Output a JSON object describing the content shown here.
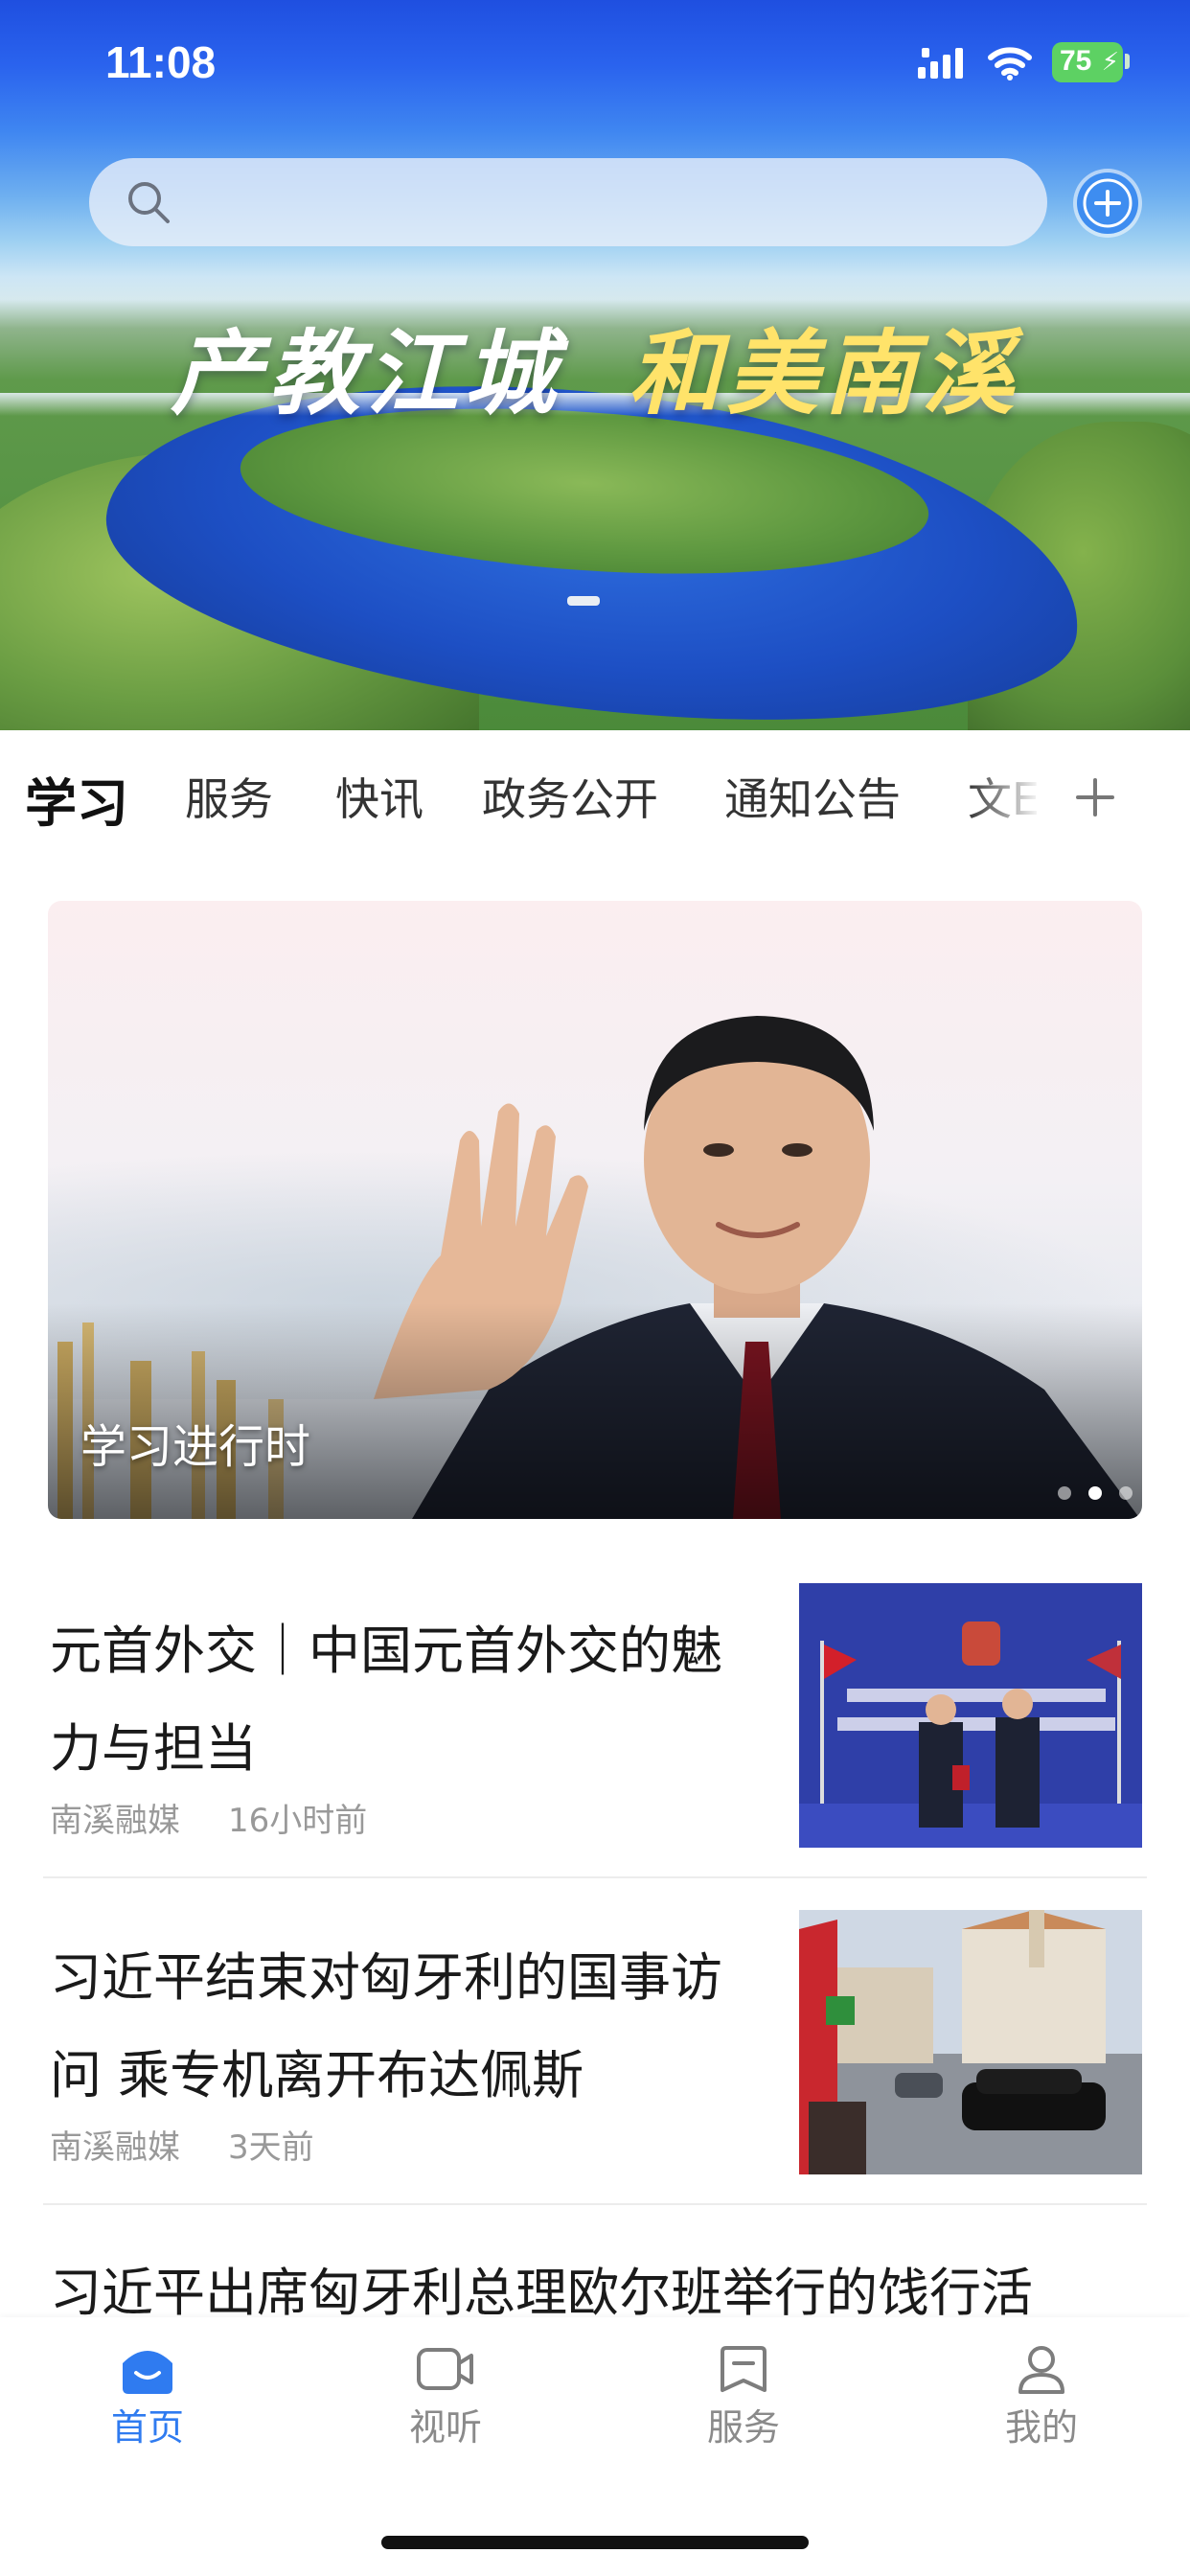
{
  "status_bar": {
    "time": "11:08",
    "battery": "75"
  },
  "header": {
    "search": {
      "placeholder": ""
    },
    "banner": {
      "slogan_part1": "产教江城",
      "slogan_part2": "和美南溪"
    }
  },
  "tabs": [
    {
      "label": "学习",
      "active": true
    },
    {
      "label": "服务"
    },
    {
      "label": "快讯"
    },
    {
      "label": "政务公开"
    },
    {
      "label": "通知公告"
    },
    {
      "label": "文E"
    }
  ],
  "carousel": {
    "caption": "学习进行时",
    "slide_count": 3,
    "active_index": 1
  },
  "news": [
    {
      "title": "元首外交｜中国元首外交的魅力与担当",
      "source": "南溪融媒",
      "time": "16小时前"
    },
    {
      "title": "习近平结束对匈牙利的国事访问 乘专机离开布达佩斯",
      "source": "南溪融媒",
      "time": "3天前"
    },
    {
      "title": "习近平出席匈牙利总理欧尔班举行的饯行活"
    }
  ],
  "bottom_nav": [
    {
      "label": "首页",
      "icon": "home-icon",
      "active": true
    },
    {
      "label": "视听",
      "icon": "video-icon"
    },
    {
      "label": "服务",
      "icon": "bookmark-icon"
    },
    {
      "label": "我的",
      "icon": "profile-icon"
    }
  ],
  "colors": {
    "accent": "#2f7bf0",
    "header_blue": "#2a63ee",
    "inactive": "#8a8a8a"
  }
}
